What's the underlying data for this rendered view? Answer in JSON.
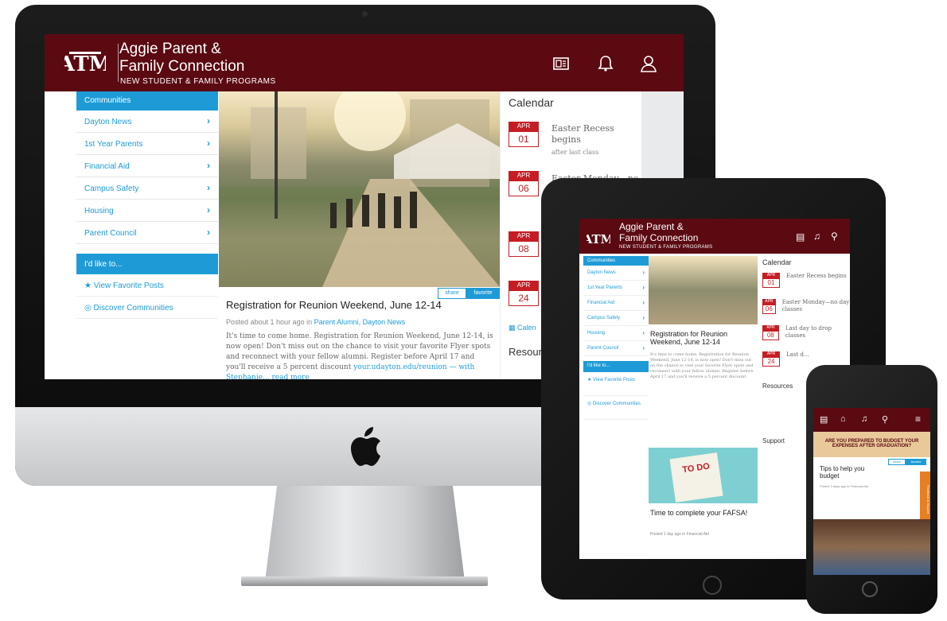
{
  "site": {
    "title_line1": "Aggie Parent &",
    "title_line2": "Family Connection",
    "subtitle": "NEW STUDENT & FAMILY PROGRAMS",
    "logo_text": "ATM"
  },
  "communities": {
    "header": "Communities",
    "items": [
      "Dayton News",
      "1st Year Parents",
      "Financial Aid",
      "Campus Safety",
      "Housing",
      "Parent Council"
    ]
  },
  "like_to": {
    "header": "I'd like to...",
    "items": [
      "View Favorite Posts",
      "Discover Communities"
    ]
  },
  "post": {
    "share_label": "share",
    "favorite_label": "favorite",
    "title": "Registration for Reunion Weekend, June 12-14",
    "meta_prefix": "Posted about 1 hour ago in",
    "meta_links": "Parent Alumni, Dayton News",
    "body": "It's time to come home. Registration for Reunion Weekend, June 12-14, is now open! Don't miss out on the chance to visit your favorite Flyer spots and reconnect with your fellow alumni. Register before April 17 and you'll receive a 5 percent discount",
    "body_link": "your.udayton.edu/reunion",
    "body_tail": "— with Stephanie... read more"
  },
  "calendar": {
    "header": "Calendar",
    "events": [
      {
        "month": "APR",
        "day": "01",
        "title": "Easter Recess begins",
        "sub": "after last class"
      },
      {
        "month": "APR",
        "day": "06",
        "title": "Easter Monday—no",
        "sub": ""
      },
      {
        "month": "APR",
        "day": "08",
        "title": "",
        "sub": ""
      },
      {
        "month": "APR",
        "day": "24",
        "title": "",
        "sub": ""
      }
    ],
    "calendar_link": "Calen",
    "resources_header": "Resour"
  },
  "ipad": {
    "events": [
      {
        "month": "APR",
        "day": "01",
        "title": "Easter Recess begins"
      },
      {
        "month": "APR",
        "day": "06",
        "title": "Easter Monday—no day classes"
      },
      {
        "month": "APR",
        "day": "08",
        "title": "Last day to drop classes"
      },
      {
        "month": "APR",
        "day": "24",
        "title": "Last d..."
      }
    ],
    "post1_title": "Registration for Reunion Weekend, June 12-14",
    "post2_title": "Time to complete your FAFSA!",
    "post2_meta": "Posted 1 day ago in Financial Aid",
    "resources": "Resources",
    "support": "Support",
    "todo": "TO DO"
  },
  "iphone": {
    "banner": "ARE YOU PREPARED TO BUDGET YOUR EXPENSES AFTER GRADUATION?",
    "post_title": "Tips to help you budget",
    "post_meta": "Posted 3 days ago in Financial Aid",
    "feedback": "Feedback & Support"
  },
  "colors": {
    "maroon": "#5b0a12",
    "blue": "#1e9bd7",
    "red": "#c41e24"
  }
}
